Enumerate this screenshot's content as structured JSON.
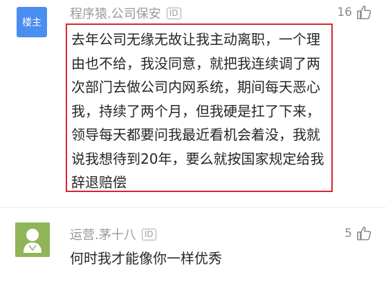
{
  "comments": [
    {
      "author": "程序猿.公司保安",
      "badge": "ID",
      "role_badge": "楼主",
      "likes": "16",
      "text": "去年公司无缘无故让我主动离职，一个理由也不给，我没同意，就把我连续调了两次部门去做公司内网系统，期间每天恶心我，持续了两个月，但我硬是扛了下来，领导每天都要问我最近看机会着没，我就说我想待到20年，要么就按国家规定给我辞退赔偿",
      "highlight_color": "#d9242f"
    },
    {
      "author": "运营.茅十八",
      "badge": "ID",
      "likes": "5",
      "text": "何时我才能像你一样优秀"
    }
  ],
  "colors": {
    "host_badge": "#4b8ef1",
    "user_avatar": "#8fb556",
    "meta_text": "#9a9a9a"
  },
  "icons": {
    "like": "thumbs-up-icon",
    "id": "id-badge-icon",
    "avatar": "user-avatar-icon"
  }
}
